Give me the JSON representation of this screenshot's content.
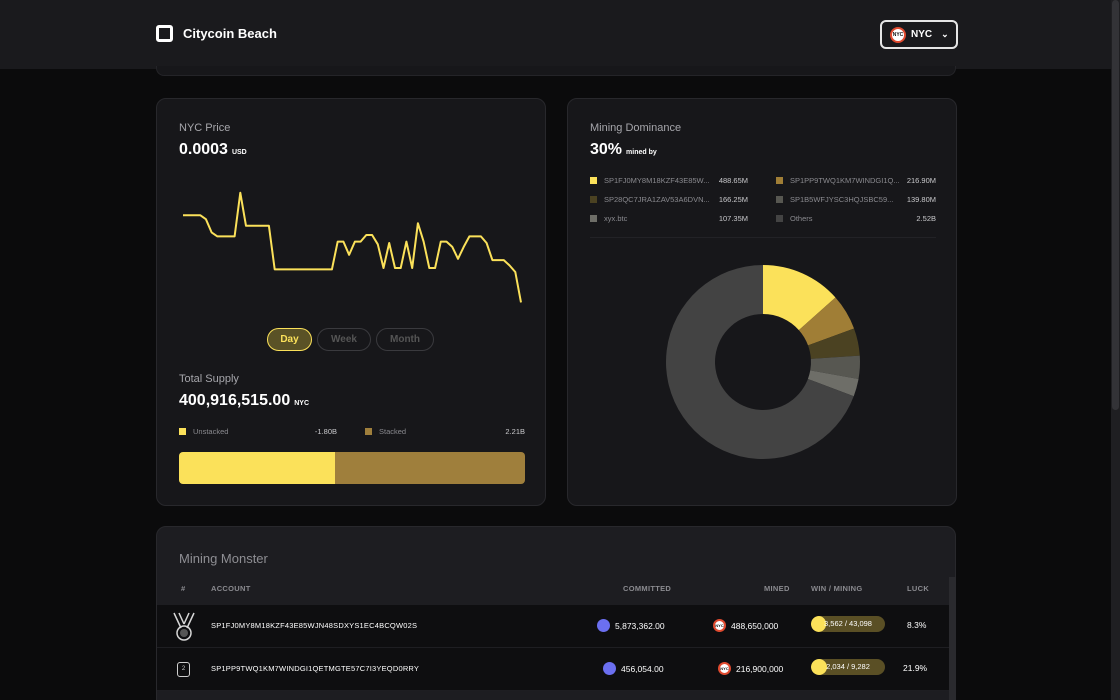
{
  "header": {
    "brand_name": "Citycoin Beach",
    "token_badge": "NYC",
    "token_label": "NYC"
  },
  "price_card": {
    "title": "NYC Price",
    "value": "0.0003",
    "unit": "USD",
    "ranges": [
      "Day",
      "Week",
      "Month"
    ],
    "active_range": "Day"
  },
  "chart_data": {
    "type": "line",
    "x": [
      0,
      1,
      2,
      3,
      4,
      5,
      6,
      7,
      8,
      9,
      10,
      11,
      12,
      13,
      14,
      15,
      16,
      17,
      18,
      19,
      20,
      21,
      22,
      23,
      24,
      25,
      26,
      27,
      28,
      29,
      30,
      31,
      32,
      33,
      34,
      35,
      36,
      37,
      38,
      39,
      40,
      41,
      42,
      43,
      44,
      45,
      46,
      47,
      48,
      49,
      50,
      51,
      52,
      53,
      54,
      55,
      56,
      57,
      58,
      59
    ],
    "values": [
      6.8,
      6.8,
      6.8,
      6.8,
      6.5,
      5.5,
      5.2,
      5.2,
      5.2,
      5.2,
      8.5,
      6.0,
      6.0,
      6.0,
      6.0,
      6.0,
      2.7,
      2.7,
      2.7,
      2.7,
      2.7,
      2.7,
      2.7,
      2.7,
      2.7,
      2.7,
      2.7,
      4.8,
      4.8,
      3.8,
      4.8,
      4.8,
      5.3,
      5.3,
      4.6,
      2.8,
      4.7,
      2.8,
      2.8,
      4.8,
      2.8,
      6.2,
      4.8,
      2.8,
      2.8,
      4.8,
      4.8,
      4.4,
      3.5,
      4.4,
      5.2,
      5.2,
      5.2,
      4.7,
      3.4,
      3.4,
      3.4,
      3.0,
      2.5,
      0.2
    ],
    "ylim": [
      0,
      10
    ],
    "grid": false,
    "color": "#fbe15a"
  },
  "supply_card": {
    "title": "Total Supply",
    "value": "400,916,515.00",
    "unit": "NYC",
    "legend": [
      {
        "label": "Unstacked",
        "value": "-1.80B",
        "color": "#fbe15a"
      },
      {
        "label": "Stacked",
        "value": "2.21B",
        "color": "#9f7f3c"
      }
    ],
    "unstacked_fraction": 0.45
  },
  "dominance_card": {
    "title": "Mining Dominance",
    "value": "30%",
    "suffix": "mined by",
    "legend": [
      {
        "label": "SP1FJ0MY8M18KZF43E85W...",
        "value": "488.65M",
        "color": "#fbe15a"
      },
      {
        "label": "SP1PP9TWQ1KM7WINDGI1Q...",
        "value": "216.90M",
        "color": "#a07e36"
      },
      {
        "label": "SP28QC7JRA1ZAV53A6DVN...",
        "value": "166.25M",
        "color": "#4b4222"
      },
      {
        "label": "SP1B5WFJYSC3HQJSBC59...",
        "value": "139.80M",
        "color": "#575751"
      },
      {
        "label": "xyx.btc",
        "value": "107.35M",
        "color": "#6e6e68"
      },
      {
        "label": "Others",
        "value": "2.52B",
        "color": "#434343"
      }
    ],
    "donut_values": [
      488.65,
      216.9,
      166.25,
      139.8,
      107.35,
      2520
    ]
  },
  "monster_card": {
    "title": "Mining Monster",
    "columns": [
      "#",
      "ACCOUNT",
      "COMMITTED",
      "MINED",
      "WIN / MINING",
      "LUCK"
    ],
    "rows": [
      {
        "rank": "medal",
        "account": "SP1FJ0MY8M18KZF43E85WJN48SDXYS1EC4BCQW02S",
        "committed": "5,873,362.00",
        "mined": "488,650,000",
        "win_mining": "3,562 / 43,098",
        "win_fraction": 0.083,
        "luck": "8.3%"
      },
      {
        "rank": "2",
        "account": "SP1PP9TWQ1KM7WINDGI1QETMGTE57C7I3YEQD0RRY",
        "committed": "456,054.00",
        "mined": "216,900,000",
        "win_mining": "2,034 / 9,282",
        "win_fraction": 0.219,
        "luck": "21.9%"
      }
    ]
  }
}
